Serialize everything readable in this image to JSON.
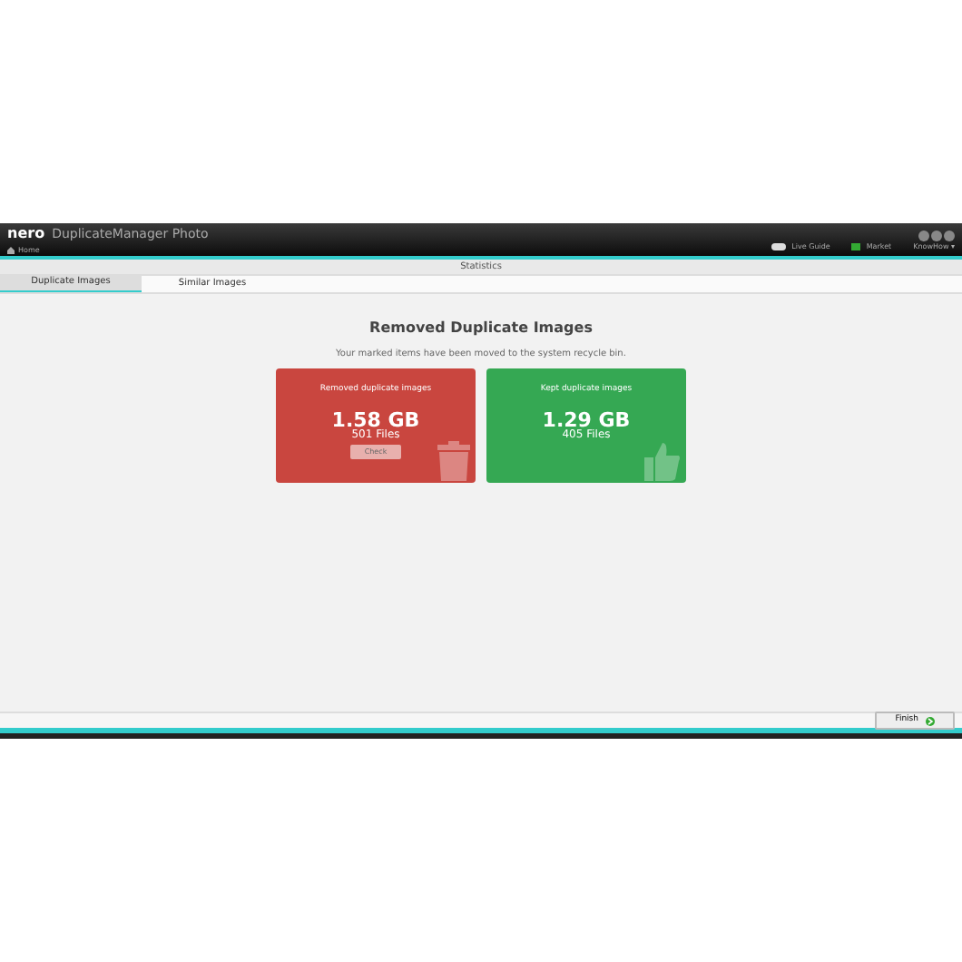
{
  "app": {
    "logo": "nero",
    "title": "DuplicateManager Photo",
    "home": "Home"
  },
  "toolbar": [
    {
      "kind": "toggle",
      "label": "Live Guide",
      "on": false
    },
    {
      "kind": "market",
      "label": "Market"
    },
    {
      "kind": "menu",
      "label": "KnowHow ▾"
    }
  ],
  "section_title": "Statistics",
  "tabs": [
    {
      "label": "Duplicate Images",
      "selected": true
    },
    {
      "label": "Similar Images",
      "selected": false
    }
  ],
  "heading": "Removed Duplicate Images",
  "message": "Your marked items have been moved to the system recycle bin.",
  "cards": [
    {
      "kind": "removed",
      "color": "#c9463f",
      "title": "Removed duplicate images",
      "size": "1.58 GB",
      "files": "501 Files",
      "button": "Check"
    },
    {
      "kind": "kept",
      "color": "#35a853",
      "title": "Kept duplicate images",
      "size": "1.29 GB",
      "files": "405 Files"
    }
  ],
  "finish": "Finish"
}
